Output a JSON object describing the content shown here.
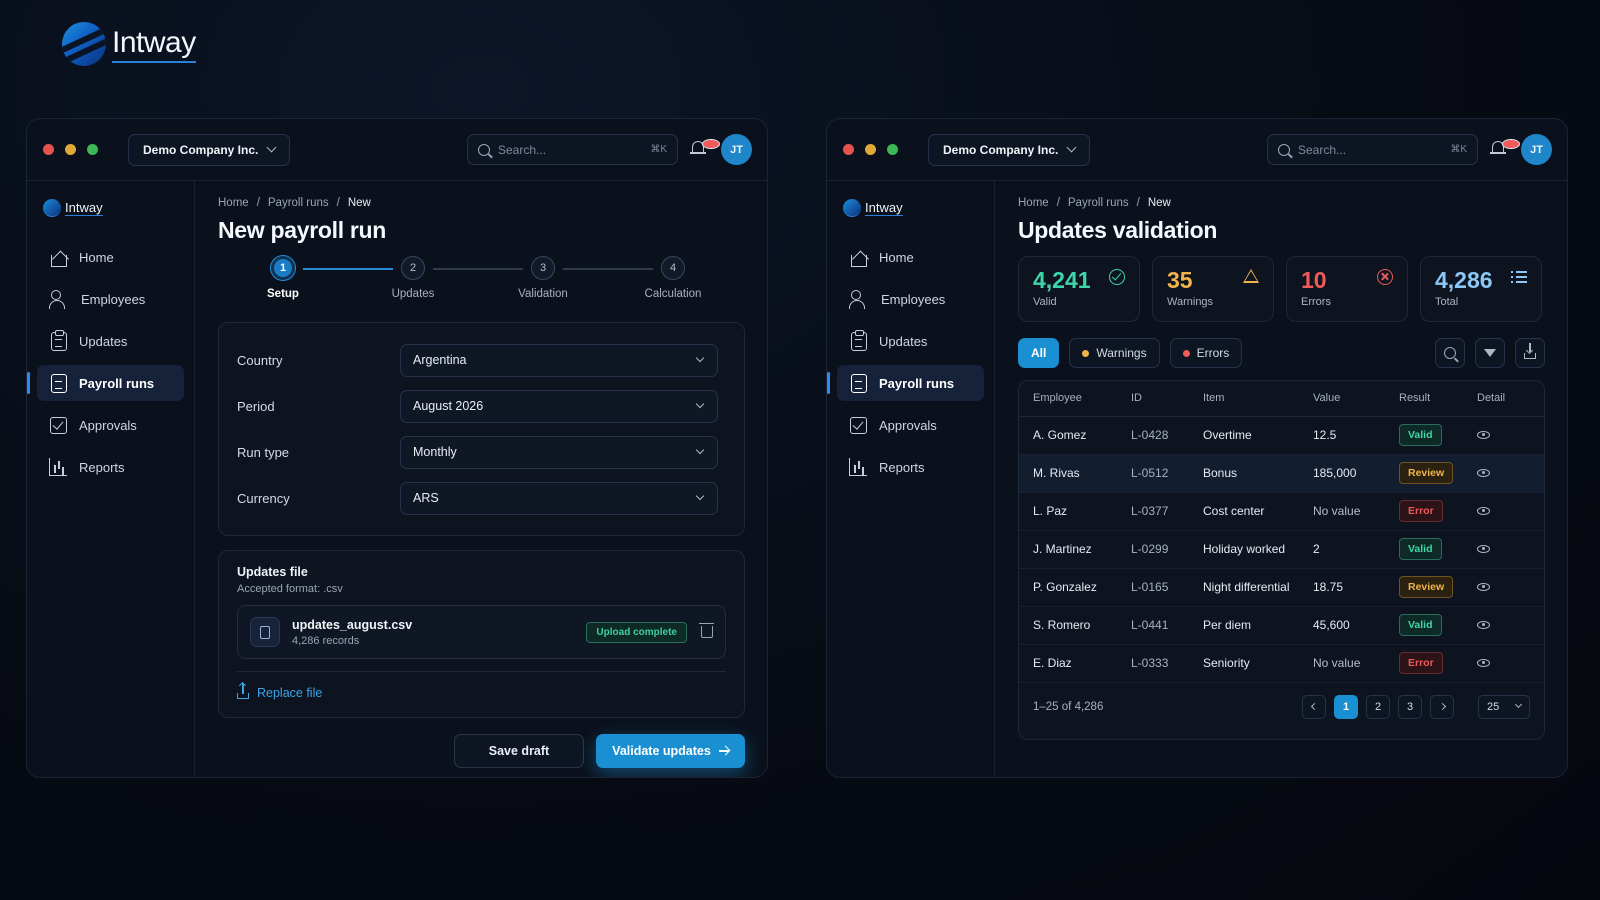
{
  "brand": {
    "name": "Intway"
  },
  "windows": {
    "left": {
      "topbar": {
        "company": "Demo Company Inc.",
        "search_placeholder": "Search...",
        "search_shortcut": "⌘K",
        "user_initials": "JT"
      },
      "sidebar": {
        "logo": "Intway",
        "items": [
          {
            "label": "Home",
            "icon": "home-icon"
          },
          {
            "label": "Employees",
            "icon": "people-icon"
          },
          {
            "label": "Updates",
            "icon": "clipboard-icon"
          },
          {
            "label": "Payroll runs",
            "icon": "document-icon",
            "active": true
          },
          {
            "label": "Approvals",
            "icon": "checkbox-icon"
          },
          {
            "label": "Reports",
            "icon": "bar-chart-icon"
          }
        ]
      },
      "breadcrumb": [
        "Home",
        "Payroll runs",
        "New"
      ],
      "title": "New payroll run",
      "steps": [
        {
          "num": "1",
          "label": "Setup",
          "active": true
        },
        {
          "num": "2",
          "label": "Updates"
        },
        {
          "num": "3",
          "label": "Validation"
        },
        {
          "num": "4",
          "label": "Calculation"
        }
      ],
      "form": {
        "country": {
          "label": "Country",
          "value": "Argentina"
        },
        "period": {
          "label": "Period",
          "value": "August 2026"
        },
        "run_type": {
          "label": "Run type",
          "value": "Monthly"
        },
        "currency": {
          "label": "Currency",
          "value": "ARS"
        }
      },
      "file": {
        "title": "Updates file",
        "accepted": "Accepted format: .csv",
        "name": "updates_august.csv",
        "records": "4,286 records",
        "status": "Upload complete",
        "replace_label": "Replace file"
      },
      "actions": {
        "save_draft": "Save draft",
        "validate": "Validate updates"
      }
    },
    "right": {
      "topbar": {
        "company": "Demo Company Inc.",
        "search_placeholder": "Search...",
        "search_shortcut": "⌘K",
        "user_initials": "JT"
      },
      "sidebar": {
        "logo": "Intway",
        "items": [
          {
            "label": "Home",
            "icon": "home-icon"
          },
          {
            "label": "Employees",
            "icon": "people-icon"
          },
          {
            "label": "Updates",
            "icon": "clipboard-icon"
          },
          {
            "label": "Payroll runs",
            "icon": "document-icon",
            "active": true
          },
          {
            "label": "Approvals",
            "icon": "checkbox-icon"
          },
          {
            "label": "Reports",
            "icon": "bar-chart-icon"
          }
        ]
      },
      "breadcrumb": [
        "Home",
        "Payroll runs",
        "New"
      ],
      "title": "Updates validation",
      "stats": [
        {
          "value": "4,241",
          "label": "Valid",
          "kind": "valid"
        },
        {
          "value": "35",
          "label": "Warnings",
          "kind": "warn"
        },
        {
          "value": "10",
          "label": "Errors",
          "kind": "err"
        },
        {
          "value": "4,286",
          "label": "Total",
          "kind": "total"
        }
      ],
      "filters": {
        "all": "All",
        "warnings": "Warnings",
        "errors": "Errors"
      },
      "table": {
        "columns": [
          "Employee",
          "ID",
          "Item",
          "Value",
          "Result",
          "Detail"
        ],
        "rows": [
          {
            "employee": "A. Gomez",
            "id": "L-0428",
            "item": "Overtime",
            "value": "12.5",
            "result": "Valid"
          },
          {
            "employee": "M. Rivas",
            "id": "L-0512",
            "item": "Bonus",
            "value": "185,000",
            "result": "Review"
          },
          {
            "employee": "L. Paz",
            "id": "L-0377",
            "item": "Cost center",
            "value": "No value",
            "result": "Error"
          },
          {
            "employee": "J. Martinez",
            "id": "L-0299",
            "item": "Holiday worked",
            "value": "2",
            "result": "Valid"
          },
          {
            "employee": "P. Gonzalez",
            "id": "L-0165",
            "item": "Night differential",
            "value": "18.75",
            "result": "Review"
          },
          {
            "employee": "S. Romero",
            "id": "L-0441",
            "item": "Per diem",
            "value": "45,600",
            "result": "Valid"
          },
          {
            "employee": "E. Diaz",
            "id": "L-0333",
            "item": "Seniority",
            "value": "No value",
            "result": "Error"
          }
        ]
      },
      "pagination": {
        "range": "1–25 of 4,286",
        "pages": [
          "1",
          "2",
          "3"
        ],
        "current": "1",
        "per_page": "25"
      }
    }
  },
  "colors": {
    "accent": "#1a8fd2",
    "valid": "#3fd6a7",
    "warning": "#f0b44a",
    "error": "#ef5a5a",
    "background": "#070b14"
  }
}
